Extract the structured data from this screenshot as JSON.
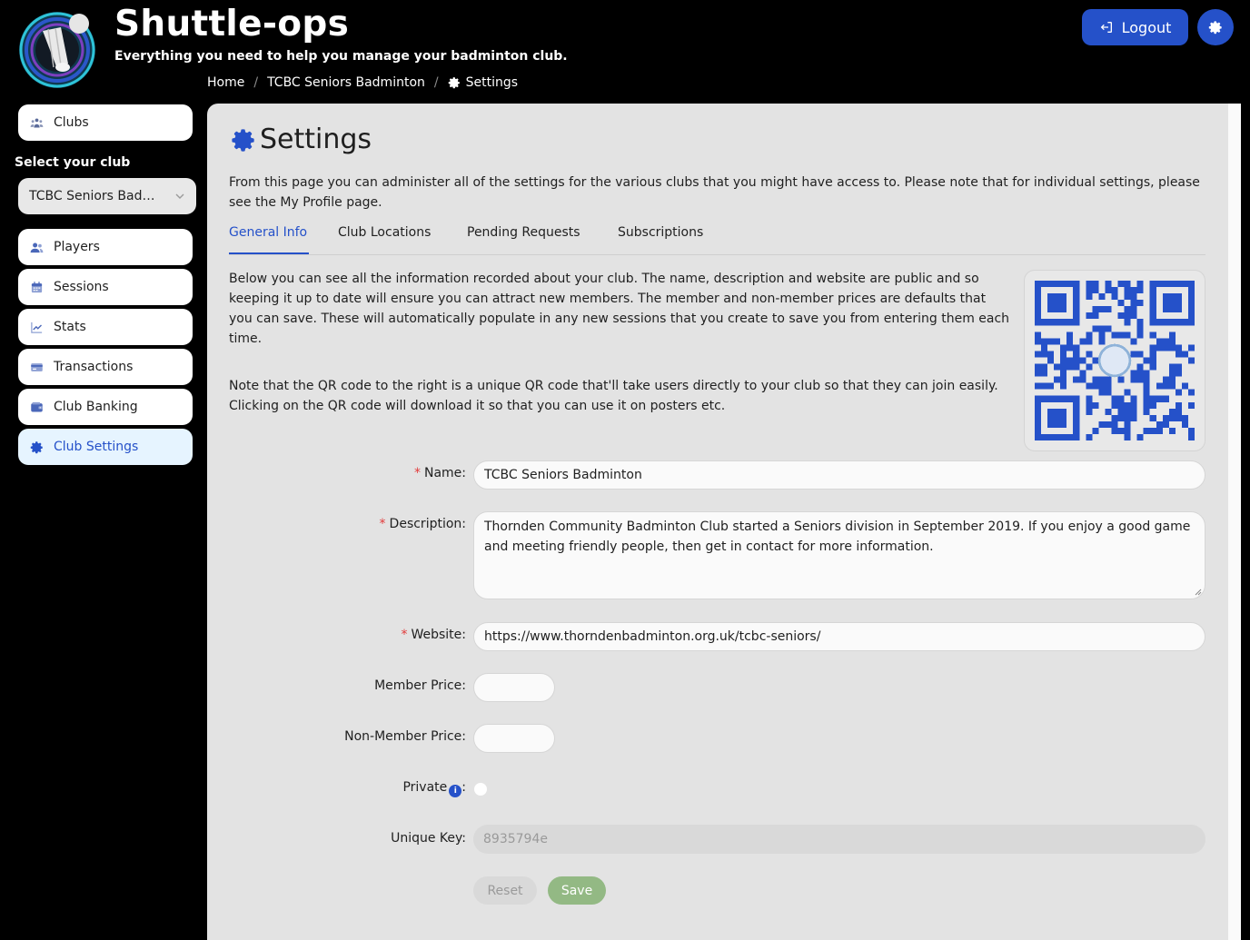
{
  "app": {
    "title": "Shuttle-ops",
    "subtitle": "Everything you need to help you manage your badminton club."
  },
  "breadcrumb": [
    "Home",
    "TCBC Seniors Badminton",
    "Settings"
  ],
  "header": {
    "logout_label": "Logout"
  },
  "sidebar": {
    "clubs_label": "Clubs",
    "select_label": "Select your club",
    "selected_club": "TCBC Seniors Badminton",
    "items": [
      {
        "label": "Players",
        "icon": "users-icon"
      },
      {
        "label": "Sessions",
        "icon": "calendar-icon"
      },
      {
        "label": "Stats",
        "icon": "chart-line-icon"
      },
      {
        "label": "Transactions",
        "icon": "credit-card-icon"
      },
      {
        "label": "Club Banking",
        "icon": "wallet-icon"
      },
      {
        "label": "Club Settings",
        "icon": "gear-icon",
        "active": true
      }
    ]
  },
  "main": {
    "title": "Settings",
    "intro": "From this page you can administer all of the settings for the various clubs that you might have access to. Please note that for individual settings, please see the My Profile page.",
    "tabs": [
      {
        "label": "General Info",
        "active": true
      },
      {
        "label": "Club Locations"
      },
      {
        "label": "Pending Requests"
      },
      {
        "label": "Subscriptions"
      }
    ],
    "paragraph1": "Below you can see all the information recorded about your club. The name, description and website are public and so keeping it up to date will ensure you can attract new members. The member and non-member prices are defaults that you can save. These will automatically populate in any new sessions that you create to save you from entering them each time.",
    "paragraph2": "Note that the QR code to the right is a unique QR code that'll take users directly to your club so that they can join easily. Clicking on the QR code will download it so that you can use it on posters etc.",
    "form": {
      "name_label": "Name",
      "name_value": "TCBC Seniors Badminton",
      "description_label": "Description",
      "description_value": "Thornden Community Badminton Club started a Seniors division in September 2019. If you enjoy a good game and meeting friendly people, then get in contact for more information.",
      "website_label": "Website",
      "website_value": "https://www.thorndenbadminton.org.uk/tcbc-seniors/",
      "member_price_label": "Member Price",
      "member_price_value": "",
      "non_member_price_label": "Non-Member Price",
      "non_member_price_value": "",
      "private_label": "Private",
      "private_checked": false,
      "unique_key_label": "Unique Key",
      "unique_key_value": "8935794e",
      "reset_label": "Reset",
      "save_label": "Save",
      "required_marker": "*",
      "colon": ":"
    }
  },
  "colors": {
    "accent": "#2551c9",
    "panel_bg": "#e3e3e3",
    "active_item_bg": "#e6f4ff",
    "save_bg": "#93b984",
    "required": "#e23b3b"
  }
}
